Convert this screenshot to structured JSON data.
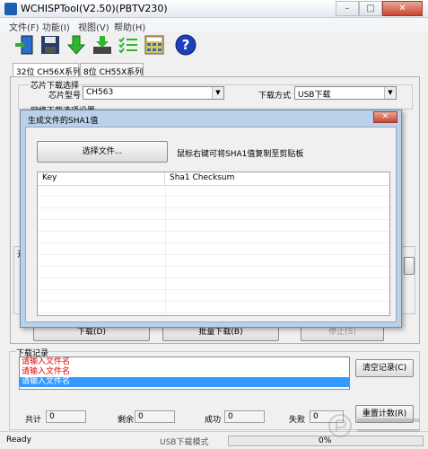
{
  "window": {
    "title": "WCHISPTool(V2.50)(PBTV230)",
    "min": "–",
    "max": "□",
    "close": "✕"
  },
  "menu": [
    "文件(F)",
    "功能(I)",
    "视图(V)",
    "帮助(H)"
  ],
  "toolbar": [
    "download-tray-icon",
    "save-disk-icon",
    "download-arrow-icon",
    "download-to-device-icon",
    "checklist-icon",
    "calculator-icon",
    "help-icon"
  ],
  "tabs": [
    "32位 CH56X系列",
    "8位 CH55X系列"
  ],
  "chip": {
    "group_label": "芯片下载选择",
    "model_label": "芯片型号",
    "model_value": "CH563",
    "mode_label": "下载方式",
    "mode_value": "USB下载"
  },
  "download_config_label": "网络下载选项设置",
  "partial_group_label": "开",
  "dialog": {
    "title": "生成文件的SHA1值",
    "close": "✕",
    "select_file": "选择文件...",
    "hint": "鼠标右键可将SHA1值复制至剪贴板",
    "columns": [
      "Key",
      "Sha1 Checksum"
    ]
  },
  "actions": {
    "download": "下载(D)",
    "batch": "批量下载(B)",
    "stop": "停止(S)"
  },
  "log": {
    "label": "下载记录",
    "lines": [
      "请输入文件名",
      "请输入文件名",
      "请输入文件名"
    ],
    "selected_index": 2,
    "clear": "清空记录(C)",
    "reset": "重置计数(R)"
  },
  "counts": {
    "total_label": "共计",
    "total": "0",
    "rest_label": "剩余",
    "rest": "0",
    "ok_label": "成功",
    "ok": "0",
    "fail_label": "失败",
    "fail": "0"
  },
  "status": {
    "ready": "Ready",
    "mode": "USB下载模式",
    "progress_text": "0%",
    "progress": 0
  },
  "colors": {
    "dialog_frame": "#b9d1ea",
    "selection": "#3399ff",
    "error_text": "#e00000",
    "progress": "#37b03a"
  }
}
